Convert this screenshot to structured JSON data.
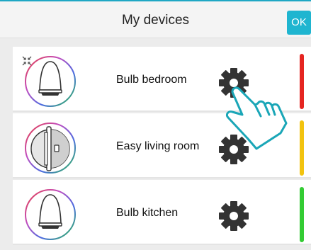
{
  "header": {
    "title": "My devices",
    "ok_label": "OK"
  },
  "devices": [
    {
      "name": "Bulb bedroom",
      "icon": "bulb-icon",
      "status_color": "#e52521"
    },
    {
      "name": "Easy living room",
      "icon": "plug-icon",
      "status_color": "#f2c30f"
    },
    {
      "name": "Bulb kitchen",
      "icon": "bulb-icon",
      "status_color": "#33cc33"
    }
  ],
  "accent_color": "#1fb5d0"
}
